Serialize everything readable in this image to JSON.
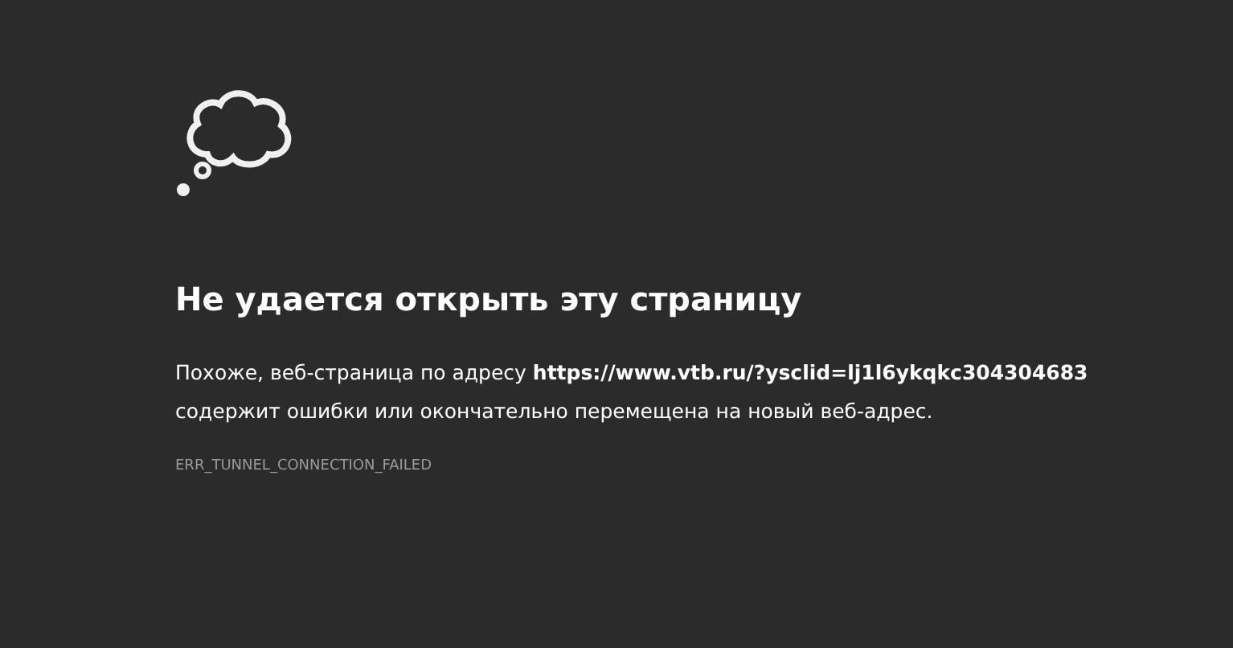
{
  "title": "Не удается открыть эту страницу",
  "message": "Похоже, веб-страница по адресу **https://www.vtb.ru/?ysclid=lj1l6ykqkc304304683** содержит ошибки или окончательно перемещена на новый веб-адрес.",
  "error_code": "ERR_TUNNEL_CONNECTION_FAILED"
}
